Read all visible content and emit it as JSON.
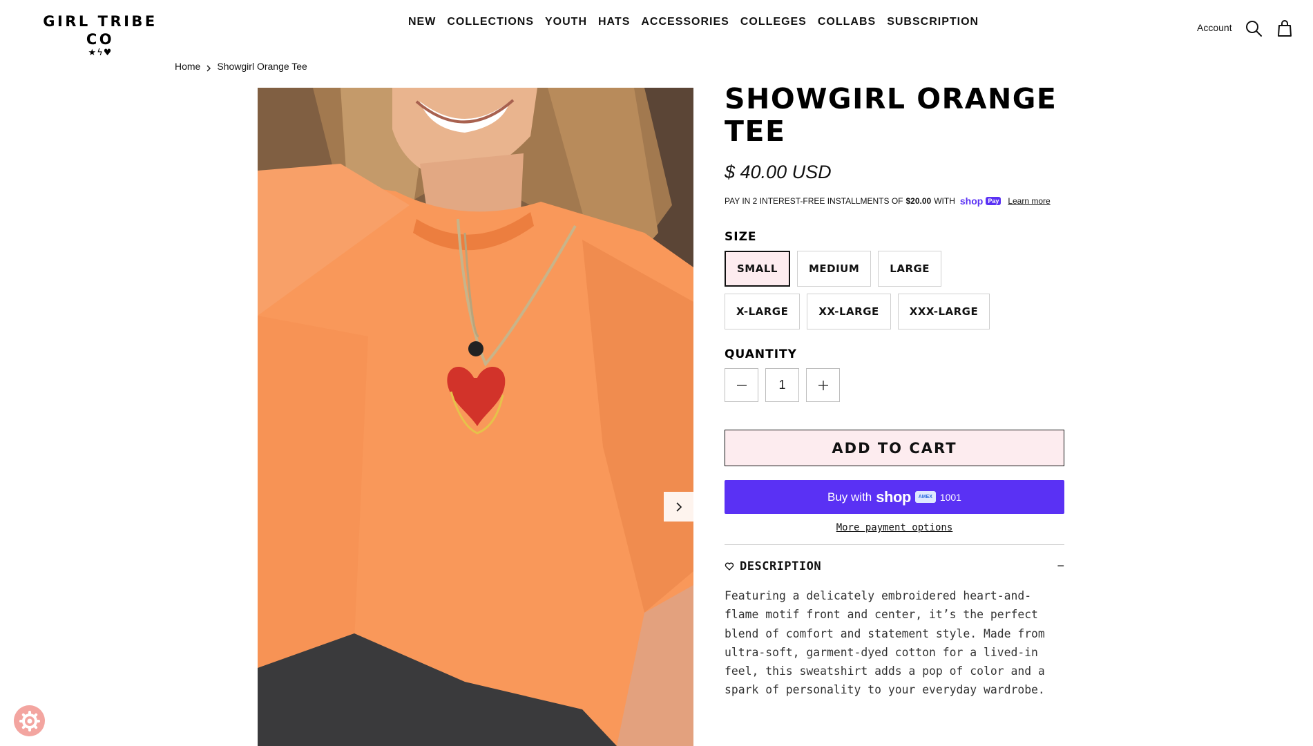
{
  "header": {
    "logo_text": "GIRL TRIBE CO",
    "logo_marks": "★ϟ♥",
    "nav": [
      "NEW",
      "COLLECTIONS",
      "YOUTH",
      "HATS",
      "ACCESSORIES",
      "COLLEGES",
      "COLLABS",
      "SUBSCRIPTION"
    ],
    "account_label": "Account",
    "icons": [
      "search-icon",
      "bag-icon"
    ]
  },
  "breadcrumb": {
    "home": "Home",
    "current": "Showgirl Orange Tee"
  },
  "product": {
    "title": "SHOWGIRL ORANGE TEE",
    "price": "$ 40.00 USD",
    "installments": {
      "prefix": "PAY IN 2 INTEREST-FREE INSTALLMENTS OF",
      "amount": "$20.00",
      "with": "WITH",
      "shop": "shop",
      "pay_badge": "Pay",
      "learn_more": "Learn more"
    },
    "size_label": "SIZE",
    "sizes": [
      "SMALL",
      "MEDIUM",
      "LARGE",
      "X-LARGE",
      "XX-LARGE",
      "XXX-LARGE"
    ],
    "selected_size": "SMALL",
    "quantity_label": "QUANTITY",
    "quantity_value": "1",
    "add_to_cart": "ADD TO CART",
    "buy_with": "Buy with",
    "buy_shop": "shop",
    "amex_text": "AMEX",
    "card_digits": "1001",
    "more_payment": "More payment options",
    "description_title": "DESCRIPTION",
    "description_toggle": "−",
    "description_body": "Featuring a delicately embroidered heart-and-flame motif front and center, it’s the perfect blend of comfort and statement style. Made from ultra-soft, garment-dyed cotton for a lived-in feel, this sweatshirt adds a pop of color and a spark of personality to your everyday wardrobe."
  },
  "colors": {
    "accent_pink": "#fdecef",
    "shop_purple": "#5a31f4",
    "tee_orange": "#f9985a",
    "cookie_badge": "#f3a5a0"
  }
}
